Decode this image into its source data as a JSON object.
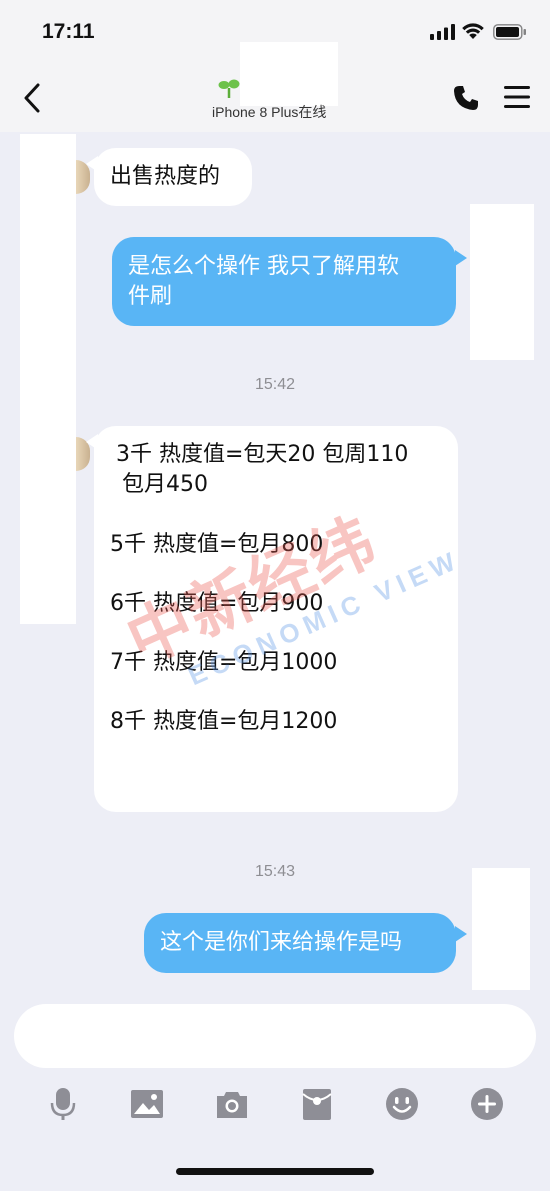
{
  "status_bar": {
    "time": "17:11"
  },
  "nav": {
    "device_status": "iPhone 8 Plus在线",
    "icons": [
      "back-icon",
      "sprout-icon",
      "phone-icon",
      "menu-icon"
    ]
  },
  "messages": {
    "m1": "出售热度的",
    "m2_line1": "是怎么个操作 我只了解用软",
    "m2_line2": "件刷",
    "time1": "15:42",
    "price": {
      "line1": "3千 热度值=包天20 包周110",
      "line1b": "包月450",
      "line2": "5千 热度值=包月800",
      "line3": "6千 热度值=包月900",
      "line4": "7千 热度值=包月1000",
      "line5": "8千 热度值=包月1200"
    },
    "time2": "15:43",
    "m4": "这个是你们来给操作是吗"
  },
  "watermark": {
    "cn": "中新经纬",
    "en": "ECONOMIC VIEW"
  },
  "colors": {
    "outgoing_bubble": "#59b5f5",
    "incoming_bubble": "#ffffff",
    "background": "#edeef6"
  },
  "toolbar": {
    "icons": [
      "microphone-icon",
      "image-icon",
      "camera-icon",
      "red-packet-icon",
      "emoji-icon",
      "plus-icon"
    ]
  }
}
